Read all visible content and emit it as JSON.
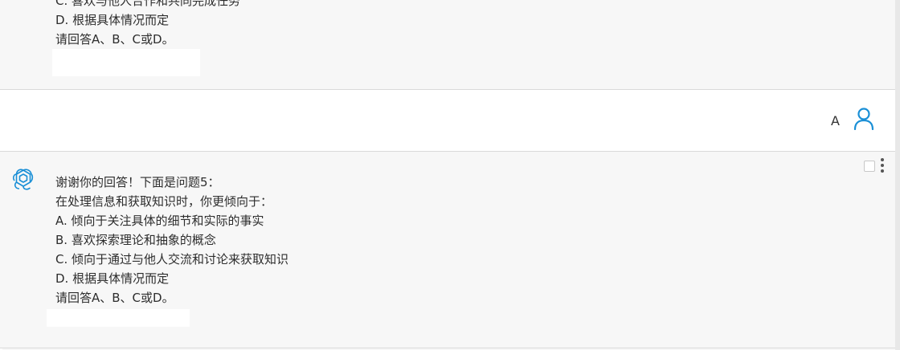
{
  "top_message": {
    "lines": [
      "C. 喜欢与他人合作和共同完成任务",
      "D. 根据具体情况而定",
      "请回答A、B、C或D。"
    ]
  },
  "user_message": {
    "text": "A"
  },
  "bottom_message": {
    "lines": [
      "谢谢你的回答！下面是问题5：",
      "在处理信息和获取知识时，你更倾向于：",
      "A. 倾向于关注具体的细节和实际的事实",
      "B. 喜欢探索理论和抽象的概念",
      "C. 倾向于通过与他人交流和讨论来获取知识",
      "D. 根据具体情况而定",
      "请回答A、B、C或D。"
    ]
  },
  "icons": {
    "assistant": "openai-logo-icon",
    "user": "user-avatar-icon",
    "more": "more-vertical-icon"
  },
  "colors": {
    "accent": "#1a8fd6",
    "assistant_bg": "#f7f7f7",
    "user_bg": "#ffffff",
    "text": "#2d2d2d"
  }
}
